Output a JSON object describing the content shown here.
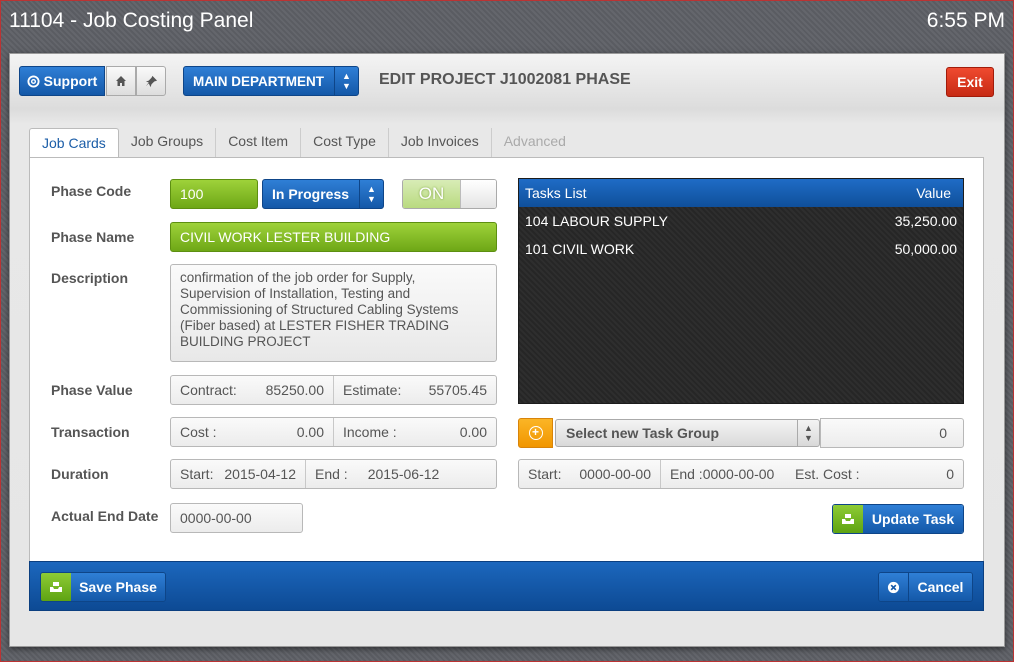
{
  "window": {
    "title": "11104 - Job Costing Panel",
    "time": "6:55 PM"
  },
  "topbar": {
    "support_label": "Support",
    "department_label": "MAIN DEPARTMENT",
    "heading": "EDIT PROJECT J1002081 PHASE",
    "exit_label": "Exit"
  },
  "tabs": [
    {
      "label": "Job Cards",
      "state": "active"
    },
    {
      "label": "Job Groups",
      "state": "normal"
    },
    {
      "label": "Cost Item",
      "state": "normal"
    },
    {
      "label": "Cost Type",
      "state": "normal"
    },
    {
      "label": "Job Invoices",
      "state": "normal"
    },
    {
      "label": "Advanced",
      "state": "disabled"
    }
  ],
  "form": {
    "phase_code_label": "Phase Code",
    "phase_code": "100",
    "status": "In Progress",
    "toggle": "ON",
    "phase_name_label": "Phase Name",
    "phase_name": "CIVIL WORK LESTER BUILDING",
    "description_label": "Description",
    "description": "confirmation of  the job order for Supply, Supervision of Installation, Testing and Commissioning of Structured Cabling Systems (Fiber based) at LESTER FISHER TRADING BUILDING PROJECT",
    "phase_value_label": "Phase Value",
    "contract_label": "Contract:",
    "contract_value": "85250.00",
    "estimate_label": "Estimate:",
    "estimate_value": "55705.45",
    "transaction_label": "Transaction",
    "cost_label": "Cost :",
    "cost_value": "0.00",
    "income_label": "Income :",
    "income_value": "0.00",
    "duration_label": "Duration",
    "start_label": "Start:",
    "start_value": "2015-04-12",
    "end_label": "End :",
    "end_value": "2015-06-12",
    "actual_end_label": "Actual End Date",
    "actual_end_value": "0000-00-00"
  },
  "tasks": {
    "header_name": "Tasks List",
    "header_value": "Value",
    "rows": [
      {
        "name": "104 LABOUR SUPPLY",
        "value": "35,250.00"
      },
      {
        "name": "101 CIVIL WORK",
        "value": "50,000.00"
      }
    ],
    "task_group_placeholder": "Select new Task Group",
    "task_group_value": "0",
    "start_label": "Start:",
    "start_value": "0000-00-00",
    "end_text": "End :0000-00-00",
    "est_cost_label": "Est. Cost :",
    "est_cost_value": "0",
    "update_label": "Update Task"
  },
  "footer": {
    "save_label": "Save Phase",
    "cancel_label": "Cancel"
  }
}
